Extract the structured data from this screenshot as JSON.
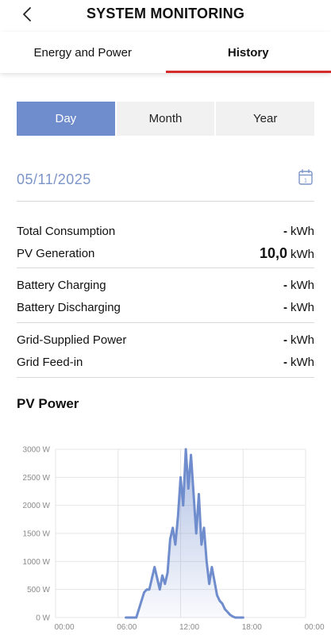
{
  "header": {
    "title": "SYSTEM MONITORING"
  },
  "tabs": [
    {
      "label": "Energy and Power",
      "active": false
    },
    {
      "label": "History",
      "active": true
    }
  ],
  "segments": [
    {
      "label": "Day",
      "active": true
    },
    {
      "label": "Month",
      "active": false
    },
    {
      "label": "Year",
      "active": false
    }
  ],
  "date": {
    "value": "05/11/2025",
    "calendar_day": "1"
  },
  "groups": [
    {
      "rows": [
        {
          "label": "Total Consumption",
          "value": "-",
          "unit": "kWh"
        },
        {
          "label": "PV Generation",
          "value": "10,0",
          "unit": "kWh"
        }
      ]
    },
    {
      "rows": [
        {
          "label": "Battery Charging",
          "value": "-",
          "unit": "kWh"
        },
        {
          "label": "Battery Discharging",
          "value": "-",
          "unit": "kWh"
        }
      ]
    },
    {
      "rows": [
        {
          "label": "Grid-Supplied Power",
          "value": "-",
          "unit": "kWh"
        },
        {
          "label": "Grid Feed-in",
          "value": "-",
          "unit": "kWh"
        }
      ]
    }
  ],
  "section": {
    "title": "PV Power"
  },
  "colors": {
    "accent_red": "#d62b2b",
    "segment_active": "#6f8ccd",
    "line": "#6f8ccd",
    "date_text": "#7c94c8"
  },
  "chart_data": {
    "type": "area",
    "title": "PV Power",
    "xlabel": "",
    "ylabel": "",
    "y_unit": "W",
    "ylim": [
      0,
      3000
    ],
    "y_ticks": [
      0,
      500,
      1000,
      1500,
      2000,
      2500,
      3000
    ],
    "y_tick_labels": [
      "0 W",
      "500 W",
      "1000 W",
      "1500 W",
      "2000 W",
      "2500 W",
      "3000 W"
    ],
    "xlim": [
      "00:00",
      "24:00"
    ],
    "x_tick_labels": [
      "00:00",
      "06:00",
      "12:00",
      "18:00",
      "00:00"
    ],
    "grid": true,
    "series": [
      {
        "x": [
          "06:45",
          "07:45",
          "08:00",
          "08:15",
          "08:30",
          "08:45",
          "09:00",
          "09:15",
          "09:30",
          "09:45",
          "10:00",
          "10:15",
          "10:30",
          "10:45",
          "11:00",
          "11:15",
          "11:30",
          "11:45",
          "12:00",
          "12:15",
          "12:30",
          "12:45",
          "13:00",
          "13:15",
          "13:30",
          "13:45",
          "14:00",
          "14:15",
          "14:30",
          "14:45",
          "15:00",
          "15:15",
          "15:30",
          "15:45",
          "16:00",
          "16:15",
          "16:30",
          "16:45",
          "17:00",
          "17:15",
          "17:30",
          "17:45",
          "18:00"
        ],
        "y": [
          0,
          0,
          150,
          300,
          450,
          500,
          500,
          700,
          900,
          700,
          500,
          750,
          600,
          800,
          1400,
          1600,
          1300,
          1800,
          2500,
          2000,
          3000,
          2300,
          2900,
          2200,
          1500,
          2200,
          1300,
          1600,
          1000,
          600,
          900,
          650,
          400,
          300,
          250,
          150,
          100,
          50,
          20,
          0,
          0,
          0,
          0
        ]
      }
    ]
  }
}
